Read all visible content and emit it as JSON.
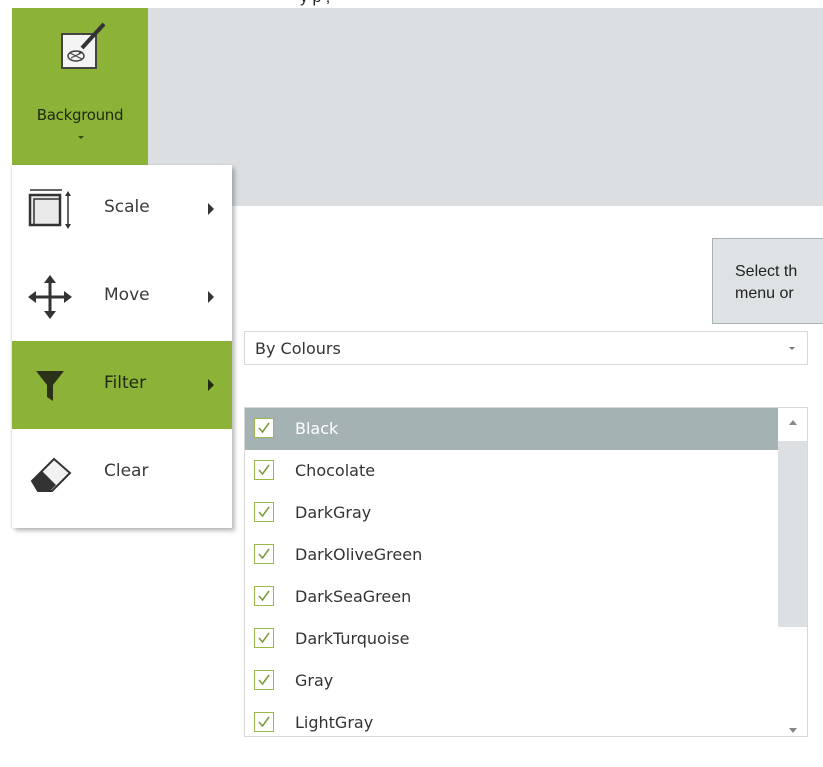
{
  "top_caption": "y   p ,",
  "ribbon": {
    "background_button_label": "Background"
  },
  "tooltip": {
    "line1": "Select th",
    "line2": "menu or"
  },
  "menu": {
    "items": [
      {
        "label": "Scale",
        "icon": "scale-icon"
      },
      {
        "label": "Move",
        "icon": "move-icon"
      },
      {
        "label": "Filter",
        "icon": "filter-icon",
        "active": true
      },
      {
        "label": "Clear",
        "icon": "eraser-icon"
      }
    ]
  },
  "filter": {
    "mode_value": "By Colours",
    "colours": [
      {
        "name": "Black",
        "checked": true,
        "selected": true
      },
      {
        "name": "Chocolate",
        "checked": true
      },
      {
        "name": "DarkGray",
        "checked": true
      },
      {
        "name": "DarkOliveGreen",
        "checked": true
      },
      {
        "name": "DarkSeaGreen",
        "checked": true
      },
      {
        "name": "DarkTurquoise",
        "checked": true
      },
      {
        "name": "Gray",
        "checked": true
      },
      {
        "name": "LightGray",
        "checked": true
      }
    ]
  },
  "colors": {
    "accent": "#8db238",
    "ribbon_bg": "#dbdfe2",
    "selected_row": "#a5b2b3"
  }
}
